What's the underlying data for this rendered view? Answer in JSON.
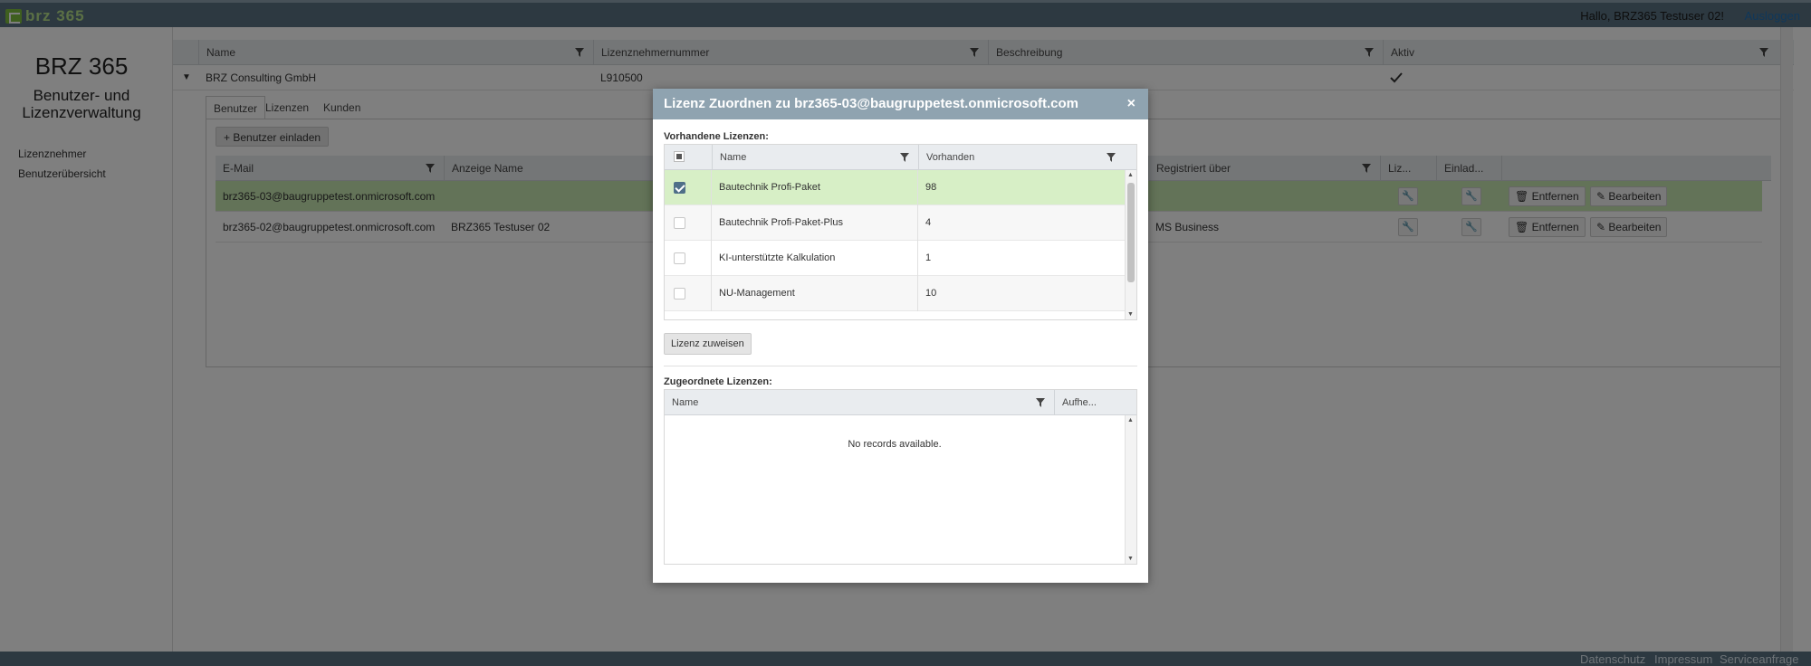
{
  "topbar": {
    "logo": "brz 365",
    "greeting": "Hallo, BRZ365 Testuser 02!",
    "logout": "Ausloggen"
  },
  "sidebar": {
    "title": "BRZ 365",
    "subtitle_line1": "Benutzer- und",
    "subtitle_line2": "Lizenzverwaltung",
    "links": [
      "Lizenznehmer",
      "Benutzerübersicht"
    ]
  },
  "grid": {
    "columns": [
      "Name",
      "Lizenznehmernummer",
      "Beschreibung",
      "Aktiv"
    ],
    "row": {
      "name": "BRZ Consulting GmbH",
      "number": "L910500",
      "description": "",
      "active_icon": "check-icon"
    }
  },
  "detail": {
    "tabs": [
      "Benutzer",
      "Lizenzen",
      "Kunden"
    ],
    "invite_button": "Benutzer einladen",
    "columns": [
      "E-Mail",
      "Anzeige Name",
      "Registriert über",
      "Liz...",
      "Einlad..."
    ],
    "rows": [
      {
        "email": "brz365-03@baugruppetest.onmicrosoft.com",
        "display_name": "",
        "registered_via": "",
        "remove": "Entfernen",
        "edit": "Bearbeiten"
      },
      {
        "email": "brz365-02@baugruppetest.onmicrosoft.com",
        "display_name": "BRZ365 Testuser 02",
        "registered_via": "MS Business",
        "remove": "Entfernen",
        "edit": "Bearbeiten"
      }
    ]
  },
  "footer": {
    "links": [
      "Datenschutz",
      "Impressum",
      "Serviceanfrage"
    ]
  },
  "modal": {
    "title": "Lizenz Zuordnen zu brz365-03@baugruppetest.onmicrosoft.com",
    "close": "×",
    "available_label": "Vorhandene Lizenzen:",
    "available_columns": [
      "Name",
      "Vorhanden"
    ],
    "available_rows": [
      {
        "name": "Bautechnik Profi-Paket",
        "count": "98",
        "checked": true
      },
      {
        "name": "Bautechnik Profi-Paket-Plus",
        "count": "4",
        "checked": false
      },
      {
        "name": "KI-unterstützte Kalkulation",
        "count": "1",
        "checked": false
      },
      {
        "name": "NU-Management",
        "count": "10",
        "checked": false
      }
    ],
    "assign_button": "Lizenz zuweisen",
    "assigned_label": "Zugeordnete Lizenzen:",
    "assigned_columns": [
      "Name",
      "Aufhe..."
    ],
    "no_records": "No records available."
  },
  "colors": {
    "topbar": "#5b7383",
    "modal_header": "#8fa3b0",
    "selected_row": "#c7e7b0",
    "logo_green": "#7fbf3f"
  }
}
